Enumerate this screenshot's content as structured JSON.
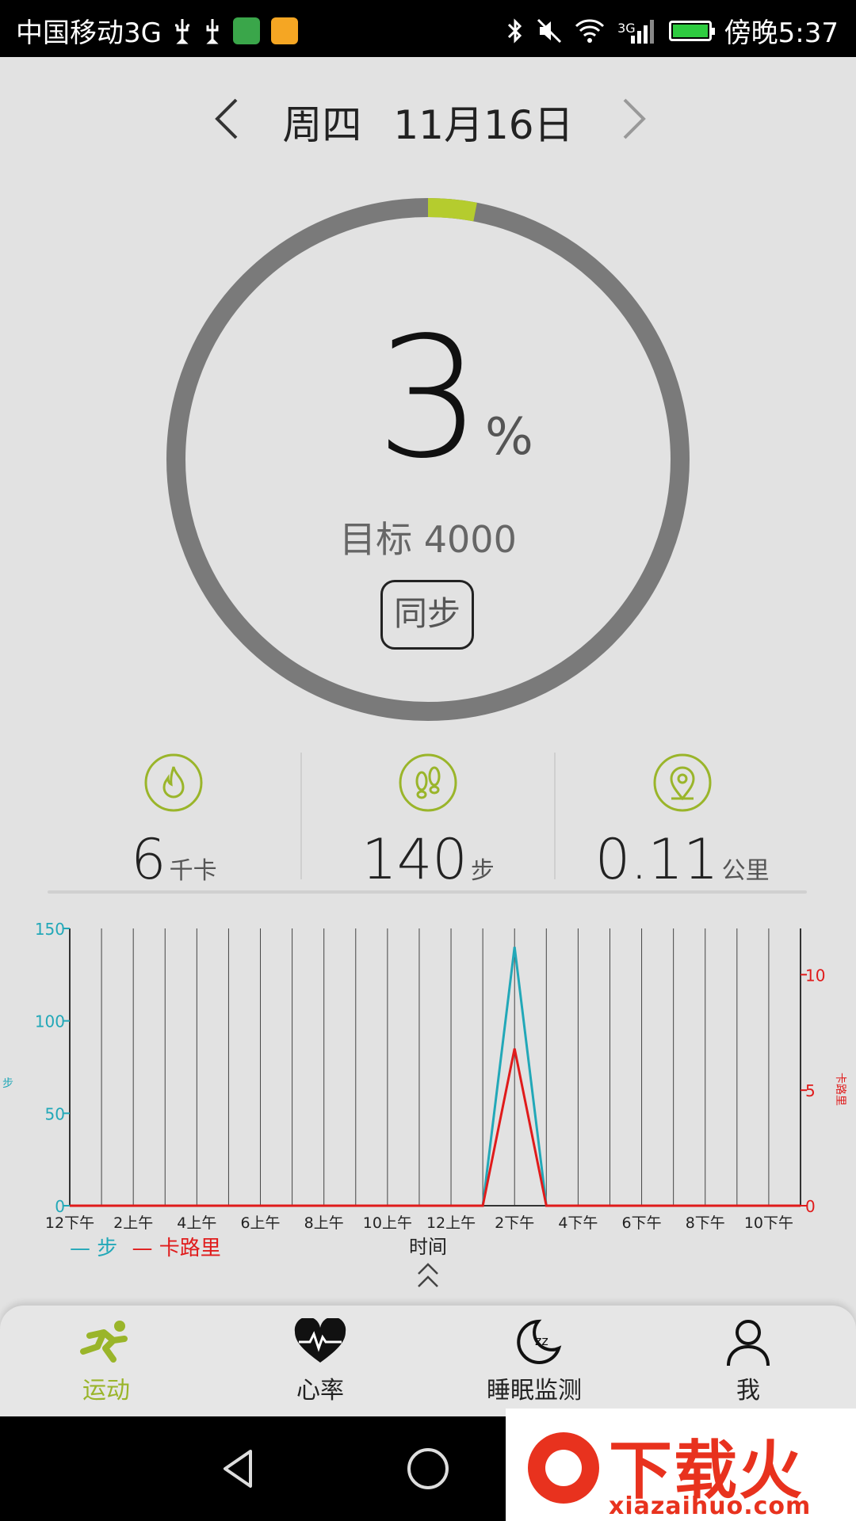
{
  "status_bar": {
    "carrier": "中国移动3G",
    "network": "3G",
    "time": "傍晚5:37",
    "icons": [
      "usb-icon",
      "usb-icon",
      "app-icon",
      "weibo-icon",
      "bluetooth-icon",
      "mute-icon",
      "wifi-icon",
      "signal-icon",
      "battery-icon"
    ],
    "battery_color": "#2ecc40"
  },
  "header": {
    "weekday": "周四",
    "date": "11月16日"
  },
  "progress": {
    "percent_value": "3",
    "percent_sign": "%",
    "fraction": 0.03,
    "goal_label": "目标 4000",
    "sync_label": "同步",
    "ring_color": "#7a7a7a",
    "accent_color": "#b5cc2e"
  },
  "stats": [
    {
      "icon": "flame-icon",
      "value": "6",
      "unit": "千卡"
    },
    {
      "icon": "footprints-icon",
      "value": "140",
      "unit": "步"
    },
    {
      "icon": "location-pin-icon",
      "value": "0.11",
      "unit": "公里"
    }
  ],
  "chart_data": {
    "type": "line",
    "x_tick_labels": [
      "12下午",
      "2上午",
      "4上午",
      "6上午",
      "8上午",
      "10上午",
      "12上午",
      "2下午",
      "4下午",
      "6下午",
      "8下午",
      "10下午"
    ],
    "xlabel": "时间",
    "y_left_label": "步",
    "y_right_label": "卡路里",
    "y_left_ticks": [
      "0",
      "50",
      "100",
      "150"
    ],
    "y_right_ticks": [
      "0",
      "5",
      "10"
    ],
    "ylim_left": [
      0,
      150
    ],
    "ylim_right": [
      0,
      12
    ],
    "hours": [
      0,
      1,
      2,
      3,
      4,
      5,
      6,
      7,
      8,
      9,
      10,
      11,
      12,
      13,
      14,
      15,
      16,
      17,
      18,
      19,
      20,
      21,
      22,
      23
    ],
    "series": [
      {
        "name": "步",
        "axis": "left",
        "color": "#22a8b8",
        "values": [
          0,
          0,
          0,
          0,
          0,
          0,
          0,
          0,
          0,
          0,
          0,
          0,
          0,
          0,
          140,
          0,
          0,
          0,
          0,
          0,
          0,
          0,
          0,
          0
        ]
      },
      {
        "name": "卡路里",
        "axis": "right",
        "color": "#e01b1b",
        "values": [
          0,
          0,
          0,
          0,
          0,
          0,
          0,
          0,
          0,
          0,
          0,
          0,
          0,
          0,
          6.8,
          0,
          0,
          0,
          0,
          0,
          0,
          0,
          0,
          0
        ]
      }
    ],
    "grid": true,
    "legend_position": "bottom-left"
  },
  "legend": {
    "steps_label": "— 步",
    "calories_label": "— 卡路里"
  },
  "tabs": [
    {
      "label": "运动",
      "icon": "running-icon",
      "active": true
    },
    {
      "label": "心率",
      "icon": "heart-rate-icon",
      "active": false
    },
    {
      "label": "睡眠监测",
      "icon": "sleep-moon-icon",
      "active": false
    },
    {
      "label": "我",
      "icon": "profile-icon",
      "active": false
    }
  ],
  "watermark": {
    "title": "下载火",
    "url": "xiazaihuo.com"
  }
}
